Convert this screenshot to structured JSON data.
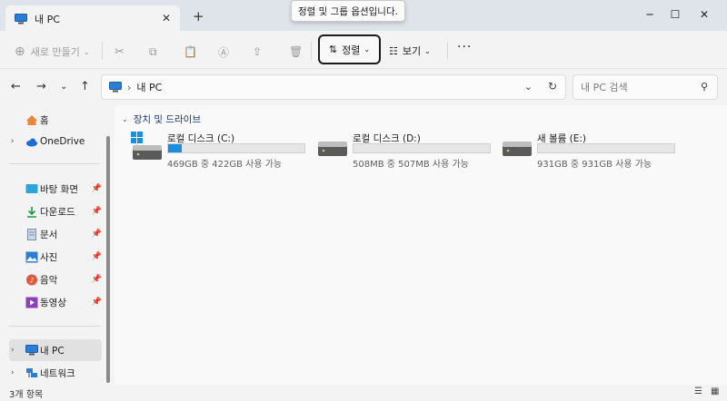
{
  "window": {
    "tab_title": "내 PC",
    "tooltip": "정렬 및 그룹 옵션입니다."
  },
  "toolbar": {
    "new_label": "새로 만들기",
    "sort_label": "정렬",
    "view_label": "보기",
    "more_label": "···"
  },
  "address": {
    "location": "내 PC",
    "search_placeholder": "내 PC 검색"
  },
  "sidebar": {
    "home": "홈",
    "onedrive": "OneDrive",
    "desktop": "바탕 화면",
    "downloads": "다운로드",
    "documents": "문서",
    "pictures": "사진",
    "music": "음악",
    "videos": "동영상",
    "this_pc": "내 PC",
    "network": "네트워크"
  },
  "main": {
    "group_title": "장치 및 드라이브",
    "drives": [
      {
        "name": "로컬 디스크 (C:)",
        "free_text": "469GB 중 422GB 사용 가능",
        "used_fraction": 0.1
      },
      {
        "name": "로컬 디스크 (D:)",
        "free_text": "508MB 중 507MB 사용 가능",
        "used_fraction": 0.0
      },
      {
        "name": "새 볼륨 (E:)",
        "free_text": "931GB 중 931GB 사용 가능",
        "used_fraction": 0.0
      }
    ]
  },
  "status": {
    "item_count": "3개 항목"
  },
  "colors": {
    "accent": "#1a8fe0",
    "selected_bg": "#e1e1e1"
  }
}
